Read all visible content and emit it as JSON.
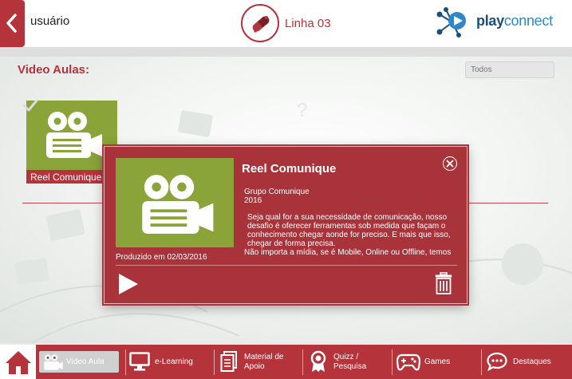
{
  "header": {
    "user_name": "usuário",
    "channel_name": "Linha 03",
    "brand": {
      "part1": "play",
      "part2": "connect"
    }
  },
  "main": {
    "section_title": "Video Aulas:",
    "filter_placeholder": "Todos",
    "videos": [
      {
        "title": "Reel Comunique",
        "watched": true
      }
    ]
  },
  "popup": {
    "title": "Reel Comunique",
    "group": "Grupo Comunique",
    "year": "2016",
    "description": [
      "Seja qual for a sua necessidade de comunicação, nosso desafio é oferecer ferramentas sob medida que façam o conhecimento chegar aonde for preciso. E mais que isso, chegar de forma precisa.",
      "Não importa a mídia, se é Mobile, Online ou Offline, temos"
    ],
    "produced": "Produzido em 02/03/2016"
  },
  "nav": {
    "items": [
      {
        "label": "Video Aula",
        "active": true
      },
      {
        "label": "e-Learning"
      },
      {
        "label_line1": "Material de",
        "label_line2": "Apoio"
      },
      {
        "label_line1": "Quizz /",
        "label_line2": "Pesquisa"
      },
      {
        "label": "Games"
      },
      {
        "label": "Destaques"
      }
    ]
  },
  "colors": {
    "brand_red": "#b5343c",
    "popup_red": "#a9333a",
    "thumb_green": "#8aa43a",
    "brand_blue": "#1d6aa8"
  }
}
